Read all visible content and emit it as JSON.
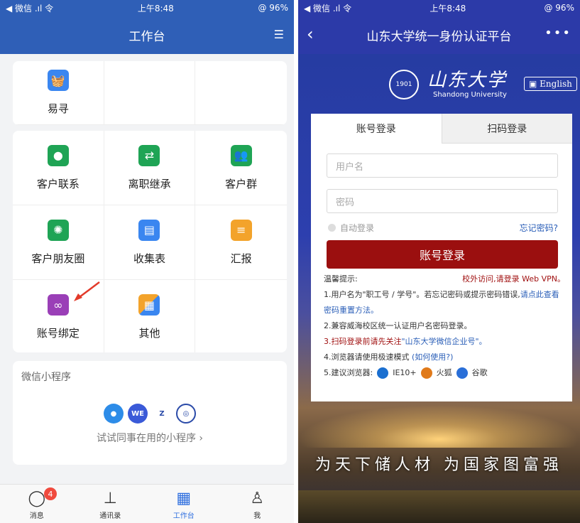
{
  "left": {
    "status": {
      "carrier": "◀ 微信 .ıl 令",
      "time": "上午8:48",
      "battery": "@ 96%"
    },
    "nav": {
      "title": "工作台",
      "right_icon": "settings-list-icon"
    },
    "top_card": {
      "items": [
        {
          "label": "易寻",
          "icon": "basket-icon"
        }
      ]
    },
    "apps": [
      {
        "label": "客户联系",
        "icon": "chat-icon",
        "color": "#1fa455"
      },
      {
        "label": "离职继承",
        "icon": "transfer-icon",
        "color": "#1fa455"
      },
      {
        "label": "客户群",
        "icon": "group-icon",
        "color": "#1fa455"
      },
      {
        "label": "客户朋友圈",
        "icon": "aperture-icon",
        "color": "#1fa455"
      },
      {
        "label": "收集表",
        "icon": "form-icon",
        "color": "#3a86f0"
      },
      {
        "label": "汇报",
        "icon": "report-icon",
        "color": "#f3a32b"
      },
      {
        "label": "账号绑定",
        "icon": "link-icon",
        "color": "#9a3fb7"
      },
      {
        "label": "其他",
        "icon": "grid-icon",
        "color": "#3a86f0"
      }
    ],
    "mini_programs": {
      "title": "微信小程序",
      "link": "试试同事在用的小程序 ›",
      "icons": [
        "chat-bubble-icon",
        "we-icon",
        "z-icon",
        "badge-icon"
      ]
    },
    "tabbar": [
      {
        "label": "消息",
        "icon": "message-icon",
        "badge": "4"
      },
      {
        "label": "通讯录",
        "icon": "org-chart-icon"
      },
      {
        "label": "工作台",
        "icon": "apps-icon"
      },
      {
        "label": "我",
        "icon": "person-icon"
      }
    ]
  },
  "right": {
    "status": {
      "carrier": "◀ 微信 .ıl 令",
      "time": "上午8:48",
      "battery": "@ 96%"
    },
    "nav": {
      "title": "山东大学统一身份认证平台",
      "more": "•••"
    },
    "logo": {
      "seal": "1901",
      "chinese": "山东大学",
      "english": "Shandong University",
      "lang_button": "English"
    },
    "login": {
      "tab_account": "账号登录",
      "tab_qr": "扫码登录",
      "username_placeholder": "用户名",
      "password_placeholder": "密码",
      "remember": "自动登录",
      "forgot": "忘记密码?",
      "submit": "账号登录"
    },
    "tips": {
      "title": "温馨提示:",
      "vpn": "校外访问,请登录 Web VPN。",
      "t1": "1.用户名为\"职工号 / 学号\"。若忘记密码或提示密码错误,",
      "t1_link": "请点此查看密码重置方法。",
      "t2": "2.兼容威海校区统一认证用户名密码登录。",
      "t3": "3.扫码登录前请先关注",
      "t3_link": "\"山东大学微信企业号\"。",
      "t4": "4.浏览器请使用极速模式",
      "t4_link": "(如何使用?)",
      "t5": "5.建议浏览器:",
      "b1": "IE10+",
      "b2": "火狐",
      "b3": "谷歌"
    },
    "banner": "为天下储人材  为国家图富强"
  }
}
